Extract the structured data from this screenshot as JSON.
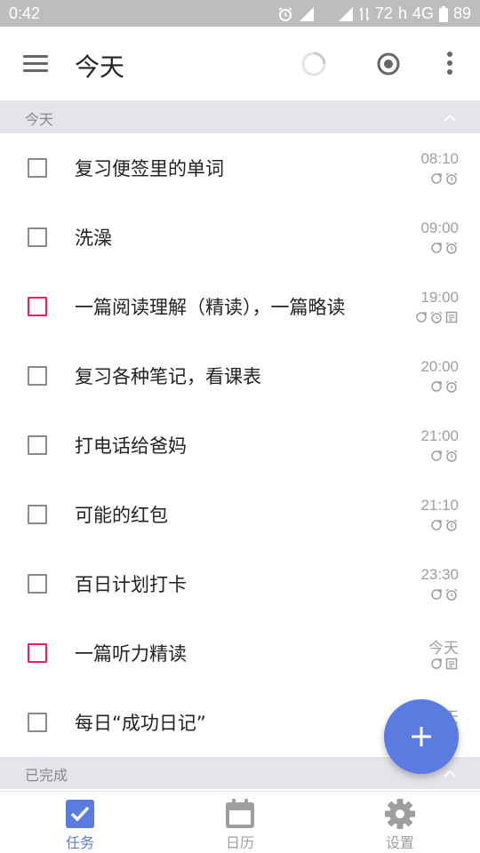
{
  "status_bar": {
    "time": "0:42",
    "signal_text": "72",
    "network_h": "h",
    "network_type": "4G",
    "battery": "89"
  },
  "header": {
    "title": "今天"
  },
  "sections": {
    "today_label": "今天",
    "completed_label": "已完成"
  },
  "tasks": [
    {
      "title": "复习便签里的单词",
      "time": "08:10",
      "icons": [
        "repeat-icon",
        "alarm-icon"
      ],
      "checkbox_color": "#8a8a8a"
    },
    {
      "title": "洗澡",
      "time": "09:00",
      "icons": [
        "repeat-icon",
        "alarm-icon"
      ],
      "checkbox_color": "#8a8a8a"
    },
    {
      "title": "一篇阅读理解（精读），一篇略读",
      "time": "19:00",
      "icons": [
        "repeat-icon",
        "alarm-icon",
        "note-icon"
      ],
      "checkbox_color": "#e91e63"
    },
    {
      "title": "复习各种笔记，看课表",
      "time": "20:00",
      "icons": [
        "repeat-icon",
        "alarm-icon"
      ],
      "checkbox_color": "#8a8a8a"
    },
    {
      "title": "打电话给爸妈",
      "time": "21:00",
      "icons": [
        "repeat-icon",
        "alarm-icon"
      ],
      "checkbox_color": "#8a8a8a"
    },
    {
      "title": "可能的红包",
      "time": "21:10",
      "icons": [
        "repeat-icon",
        "alarm-icon"
      ],
      "checkbox_color": "#8a8a8a"
    },
    {
      "title": "百日计划打卡",
      "time": "23:30",
      "icons": [
        "repeat-icon",
        "alarm-icon"
      ],
      "checkbox_color": "#8a8a8a"
    },
    {
      "title": "一篇听力精读",
      "time": "今天",
      "icons": [
        "repeat-icon",
        "note-icon"
      ],
      "checkbox_color": "#e91e63"
    },
    {
      "title": "每日“成功日记”",
      "time": "今天",
      "icons": [],
      "checkbox_color": "#8a8a8a"
    }
  ],
  "bottom_nav": [
    {
      "label": "任务",
      "icon": "task-check-icon",
      "active": true
    },
    {
      "label": "日历",
      "icon": "calendar-icon",
      "active": false
    },
    {
      "label": "设置",
      "icon": "settings-gear-icon",
      "active": false
    }
  ],
  "colors": {
    "accent": "#5c7be0",
    "priority": "#e91e63",
    "section_bg": "#e3e5ea",
    "status_bar": "#bdbdbd"
  }
}
